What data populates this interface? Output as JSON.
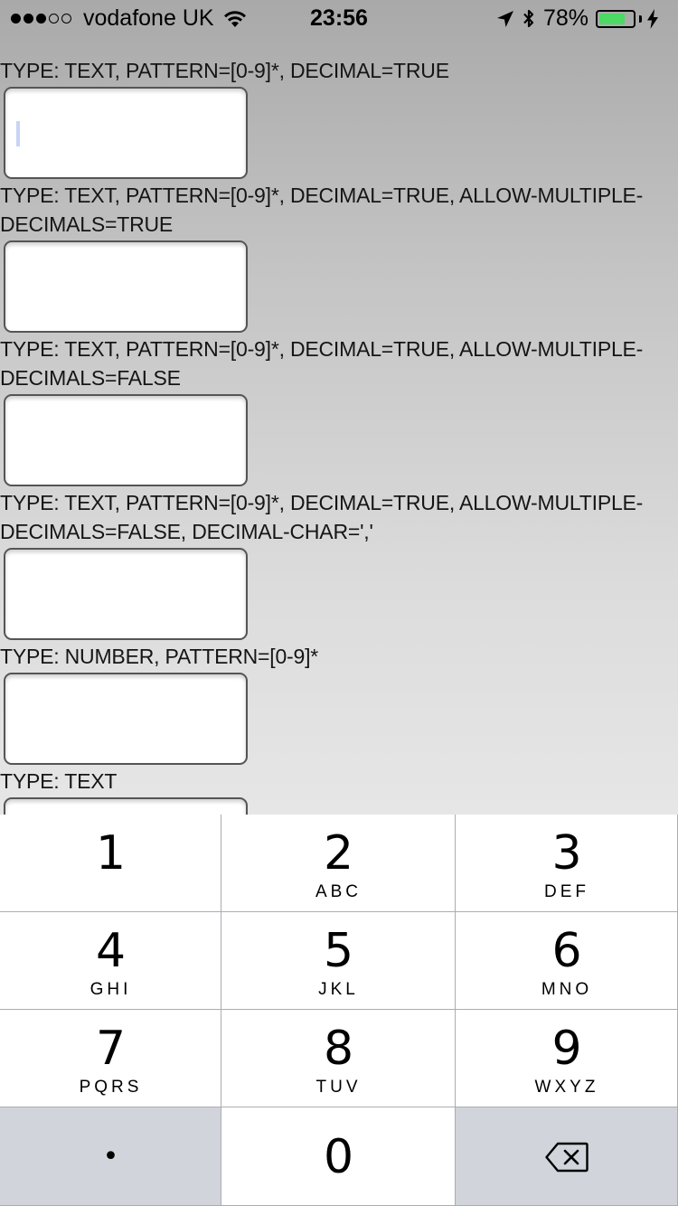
{
  "status_bar": {
    "carrier": "vodafone UK",
    "time": "23:56",
    "battery_percent": "78%",
    "battery_level": 0.78,
    "signal_bars_filled": 3,
    "signal_bars_total": 5,
    "icons": [
      "signal-dots-icon",
      "wifi-icon",
      "location-arrow-icon",
      "bluetooth-icon",
      "battery-icon",
      "charging-bolt-icon"
    ],
    "battery_color": "#4cd964"
  },
  "fields": [
    {
      "label": "TYPE: TEXT, PATTERN=[0-9]*, DECIMAL=TRUE",
      "value": "",
      "focused": true
    },
    {
      "label": "TYPE: TEXT, PATTERN=[0-9]*, DECIMAL=TRUE, ALLOW-MULTIPLE-DECIMALS=TRUE",
      "value": ""
    },
    {
      "label": "TYPE: TEXT, PATTERN=[0-9]*, DECIMAL=TRUE, ALLOW-MULTIPLE-DECIMALS=FALSE",
      "value": ""
    },
    {
      "label": "TYPE: TEXT, PATTERN=[0-9]*, DECIMAL=TRUE, ALLOW-MULTIPLE-DECIMALS=FALSE, DECIMAL-CHAR=','",
      "value": ""
    },
    {
      "label": "TYPE: NUMBER, PATTERN=[0-9]*",
      "value": ""
    },
    {
      "label": "TYPE: TEXT",
      "value": ""
    }
  ],
  "keypad": {
    "keys": [
      {
        "digit": "1",
        "letters": ""
      },
      {
        "digit": "2",
        "letters": "ABC"
      },
      {
        "digit": "3",
        "letters": "DEF"
      },
      {
        "digit": "4",
        "letters": "GHI"
      },
      {
        "digit": "5",
        "letters": "JKL"
      },
      {
        "digit": "6",
        "letters": "MNO"
      },
      {
        "digit": "7",
        "letters": "PQRS"
      },
      {
        "digit": "8",
        "letters": "TUV"
      },
      {
        "digit": "9",
        "letters": "WXYZ"
      }
    ],
    "decimal_key": "•",
    "zero_key": "0",
    "delete_icon": "backspace-icon"
  }
}
